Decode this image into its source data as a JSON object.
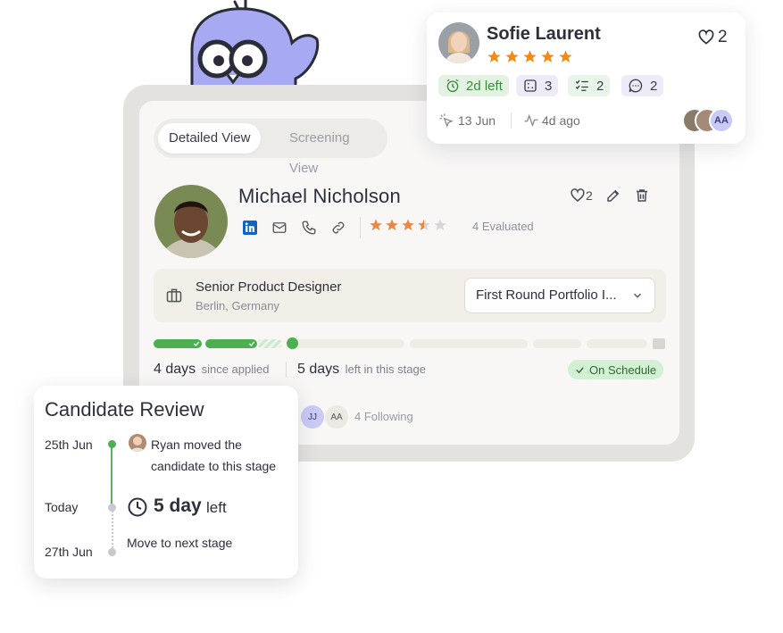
{
  "main_card": {
    "views": [
      "Detailed View",
      "Screening View"
    ],
    "candidate_name": "Michael Nicholson",
    "rating_value": 3.5,
    "rating_max": 5,
    "evaluated": "4 Evaluated",
    "likes": "2",
    "job_title": "Senior Product Designer",
    "job_location": "Berlin, Germany",
    "stage": "First Round Portfolio I...",
    "days_applied": "4 days",
    "days_applied_suffix": "since applied",
    "days_left": "5 days",
    "days_left_suffix": "left in this stage",
    "on_schedule": "On Schedule",
    "followers": [
      "JJ",
      "AA"
    ],
    "following": "4 Following"
  },
  "sofie_card": {
    "name": "Sofie Laurent",
    "likes": "2",
    "rating_value": 5,
    "chips": {
      "time_left": "2d left",
      "notes": "3",
      "tasks": "2",
      "comments": "2"
    },
    "date": "13 Jun",
    "activity": "4d ago",
    "avatar_initials": "AA"
  },
  "review_card": {
    "title": "Candidate Review",
    "events": [
      {
        "date": "25th Jun",
        "text": "Ryan moved the candidate to this stage"
      },
      {
        "date": "Today",
        "days": "5 day",
        "suffix": "left"
      },
      {
        "date": "27th Jun",
        "text": "Move to next stage"
      }
    ]
  },
  "colors": {
    "accent_green": "#4caf50",
    "star_orange": "#e8894a",
    "mascot_lavender": "#a8a9f3"
  }
}
